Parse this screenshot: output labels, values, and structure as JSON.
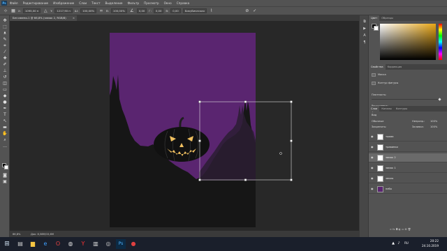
{
  "menu": {
    "app_logo": "Ps",
    "items": [
      "Файл",
      "Редактирование",
      "Изображение",
      "Слои",
      "Текст",
      "Выделение",
      "Фильтр",
      "Просмотр",
      "Окно",
      "Справка"
    ]
  },
  "options": {
    "x_label": "X:",
    "x_value": "1095,00 п",
    "y_label": "Y:",
    "y_value": "1217,90 п",
    "w_label": "Ш:",
    "w_value": "100,00%",
    "h_label": "В:",
    "h_value": "100,00%",
    "angle_value": "0,00",
    "hskew_label": "Г:",
    "hskew_value": "0,00",
    "vskew_label": "В:",
    "vskew_value": "0,00",
    "interp_value": "Бикубическая"
  },
  "document": {
    "tab_title": "Без имени-1 @ 66,8% (замок 2, RGB/8)"
  },
  "colors": {
    "sky": "#5a2570",
    "silhouette": "#161616",
    "pumpkin_face": "#f0c060",
    "accent": "#2b5fd9",
    "panel": "#535353"
  },
  "panels": {
    "color_tabs": [
      "Цвет",
      "Образцы"
    ],
    "properties_tabs": [
      "Свойства",
      "Коррекция"
    ],
    "properties_title": "Маска",
    "properties_subtitle": "Контур фигуры",
    "density_label": "Плотность:",
    "feather_label": "Растушевка:",
    "layers_tabs": [
      "Слои",
      "Каналы",
      "Контуры"
    ],
    "layers_kind": "Вид",
    "layers_blend": "Обычные",
    "layers_opacity_label": "Непрозр.:",
    "layers_opacity_value": "100%",
    "layers_lock_label": "Закрепить:",
    "layers_fill_label": "Заливка:",
    "layers_fill_value": "100%",
    "layers": [
      {
        "name": "тыква",
        "selected": false,
        "thumb": "#ffffff"
      },
      {
        "name": "травинки",
        "selected": false,
        "thumb": "#ffffff"
      },
      {
        "name": "замок 2",
        "selected": true,
        "thumb": "#ffffff"
      },
      {
        "name": "замок 1",
        "selected": false,
        "thumb": "#ffffff"
      },
      {
        "name": "земля",
        "selected": false,
        "thumb": "#ffffff"
      },
      {
        "name": "небо",
        "selected": false,
        "thumb": "#5a2570"
      }
    ]
  },
  "status": {
    "zoom": "66,8%",
    "doc_size": "Док: 8,58М/15,6М"
  },
  "taskbar": {
    "lang": "RU",
    "time": "20:22",
    "date": "24.10.2019"
  }
}
